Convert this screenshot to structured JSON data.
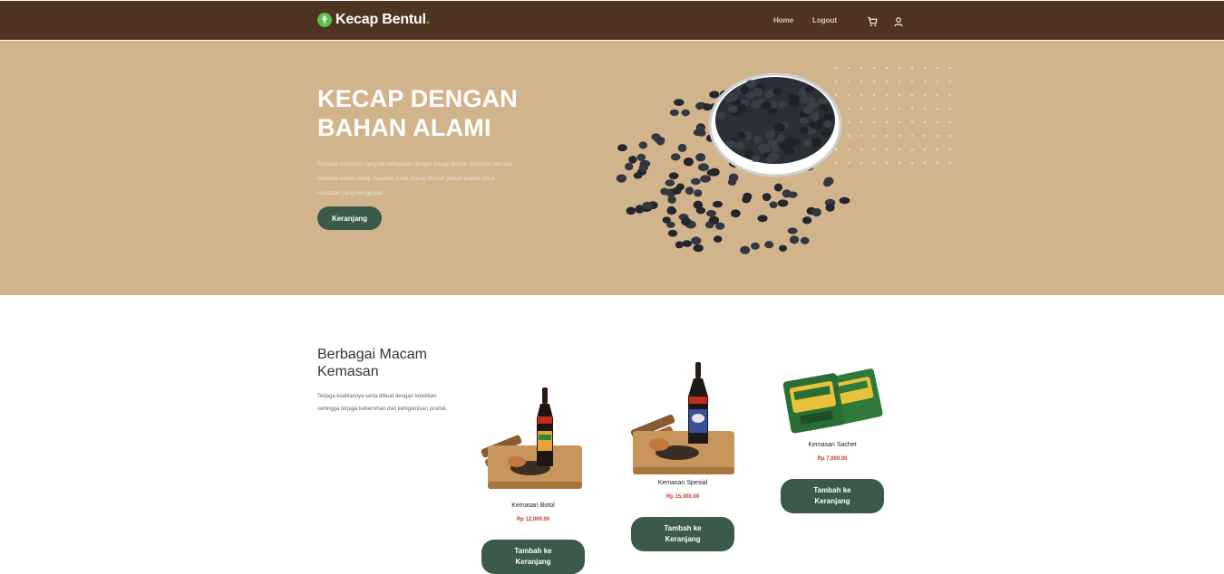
{
  "navbar": {
    "brand": "Kecap Bentul",
    "brand_dot": ".",
    "links": [
      "Home",
      "Logout"
    ],
    "icons": [
      "leaf-icon",
      "cart-icon",
      "user-icon"
    ]
  },
  "hero": {
    "title": "KECAP DENGAN BAHAN ALAMI",
    "description": "Rasakan kelezatan yang tak terlupakan dengan Kecap Bentul. Ciptakan cita rasa istimewa dalam setiap masakan Anda. Kecap Bentul, pilihan terbaik untuk kelezatan yang menggoda!",
    "button": "Keranjang"
  },
  "products_section": {
    "title": "Berbagai Macam Kemasan",
    "description": "Terjaga kualitasnya serta dibuat dengan ketelitian sehingga terjaga kebersihan dan kehigienisan produk.",
    "items": [
      {
        "name": "Kemasan Botol",
        "price": "Rp 12,000.00",
        "button": "Tambah ke Keranjang"
      },
      {
        "name": "Kemasan Spesial",
        "price": "Rp 15,000.00",
        "button": "Tambah ke Keranjang"
      },
      {
        "name": "Kemasan Sachet",
        "price": "Rp 7,000.00",
        "button": "Tambah ke Keranjang"
      }
    ]
  },
  "colors": {
    "navbar": "#4e3421",
    "hero": "#d2b48c",
    "button": "#3b5a4a",
    "accent": "#5bbf4d",
    "price": "#c0392b"
  }
}
